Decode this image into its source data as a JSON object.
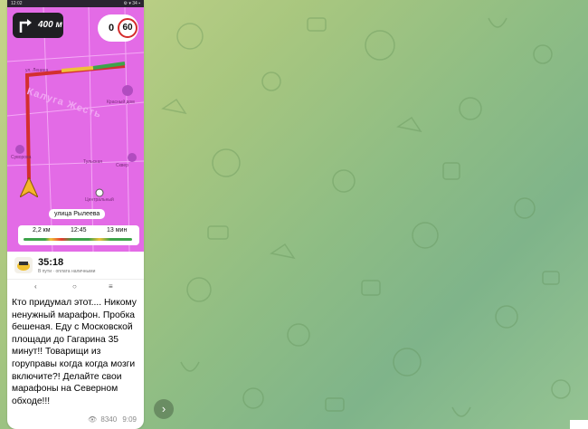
{
  "screenshot": {
    "status_time": "12:02",
    "status_icons": "⚙ ▾ 34 ▪",
    "nav_distance": "400 м",
    "current_speed": "0",
    "speed_limit": "60",
    "map_labels": {
      "banner": "Калуга Жесть",
      "street1": "ул. Ленина",
      "street2": "Тульская",
      "poi1": "Красный дом",
      "poi2": "Сквер",
      "poi3": "Суворова",
      "poi4": "Центральный"
    },
    "street_label": "улица Рылеева",
    "route": {
      "distance": "2,2 км",
      "arrival": "12:45",
      "duration": "13 мин",
      "progress_fraction": 0.1
    },
    "eta": "35:18",
    "eta_sub": "В пути · оплата наличными"
  },
  "message": {
    "text": "Кто придумал этот.... Никому ненужный марафон. Пробка бешеная. Еду с Московской площади до Гагарина 35 минут!! Товарищи из горуправы когда когда мозги включите?! Делайте свои марафоны на Северном обходе!!!",
    "views": "8340",
    "time": "9:09"
  },
  "icons": {
    "turn": "turn-right-arrow-icon",
    "views": "eye-icon",
    "share": "share-arrow-icon",
    "position": "navigation-arrow-icon"
  },
  "colors": {
    "map_bg": "#e36be6",
    "route_green": "#3da34a",
    "route_red": "#e53b30",
    "speed_limit_ring": "#d42b2b"
  }
}
